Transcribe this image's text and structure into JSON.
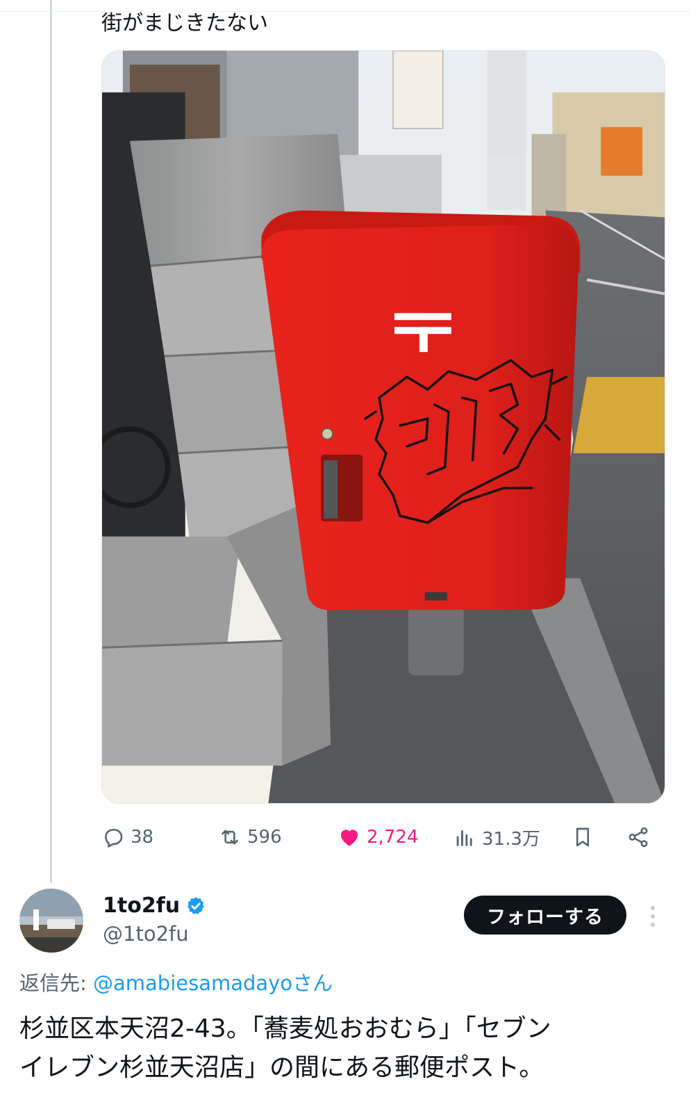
{
  "parent_tweet": {
    "text": "街がまじきたない",
    "stats": {
      "replies": "38",
      "reposts": "596",
      "likes": "2,724",
      "views": "31.3万"
    },
    "like_color": "#f91880"
  },
  "reply_tweet": {
    "author": {
      "display_name": "1to2fu",
      "handle": "@1to2fu",
      "verified": true
    },
    "follow_button_label": "フォローする",
    "reply_to_prefix": "返信先: ",
    "reply_to_mention": "@amabiesamadayo",
    "reply_to_suffix": "さん",
    "text_line1": "杉並区本天沼2-43。「蕎麦処おおむら」「セブン",
    "text_line2": "イレブン杉並天沼店」の間にある郵便ポスト。"
  },
  "icons": [
    "reply-icon",
    "repost-icon",
    "like-icon",
    "views-icon",
    "bookmark-icon",
    "share-icon",
    "verified-badge-icon",
    "more-icon"
  ],
  "colors": {
    "text_primary": "#0f1419",
    "text_secondary": "#536471",
    "link": "#1d9bf0",
    "verified": "#1d9bf0",
    "postbox_red": "#e0231f"
  }
}
